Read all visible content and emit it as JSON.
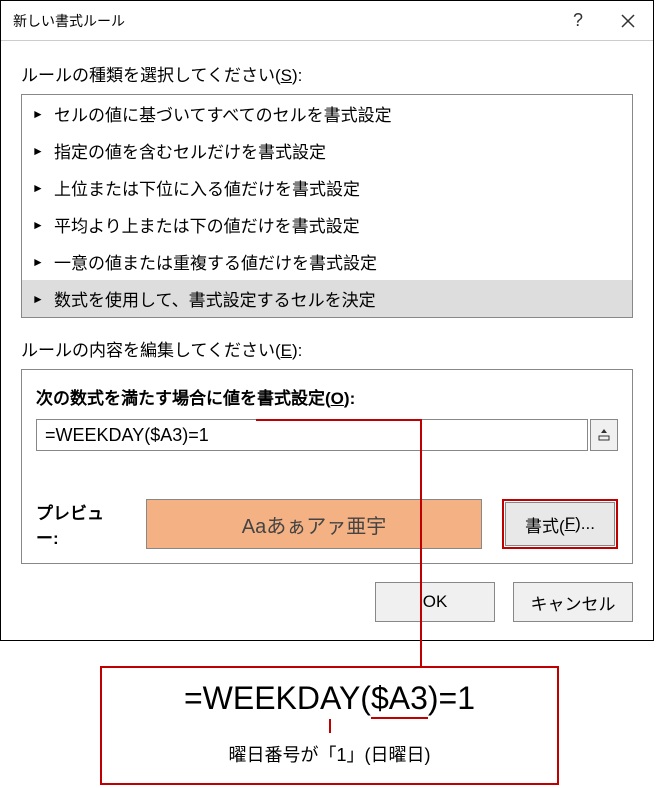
{
  "titlebar": {
    "title": "新しい書式ルール"
  },
  "labels": {
    "selectRuleType": "ルールの種類を選択してください(",
    "selectRuleTypeKey": "S",
    "selectRuleTypeEnd": "):",
    "editRuleDesc": "ルールの内容を編集してください(",
    "editRuleDescKey": "E",
    "editRuleDescEnd": "):",
    "formulaCondition": "次の数式を満たす場合に値を書式設定(",
    "formulaConditionKey": "O",
    "formulaConditionEnd": "):",
    "preview": "プレビュー:",
    "formatBtn": "書式(",
    "formatBtnKey": "F",
    "formatBtnEnd": ")...",
    "ok": "OK",
    "cancel": "キャンセル"
  },
  "ruleTypes": [
    "セルの値に基づいてすべてのセルを書式設定",
    "指定の値を含むセルだけを書式設定",
    "上位または下位に入る値だけを書式設定",
    "平均より上または下の値だけを書式設定",
    "一意の値または重複する値だけを書式設定",
    "数式を使用して、書式設定するセルを決定"
  ],
  "selectedRuleIndex": 5,
  "formula": "=WEEKDAY($A3)=1",
  "previewText": "Aaあぁアァ亜宇",
  "annotation": {
    "formulaPrefix": "=WEEKDAY(",
    "formulaCell": "$A3",
    "formulaSuffix": ")=1",
    "caption": "曜日番号が「1」(日曜日)"
  }
}
